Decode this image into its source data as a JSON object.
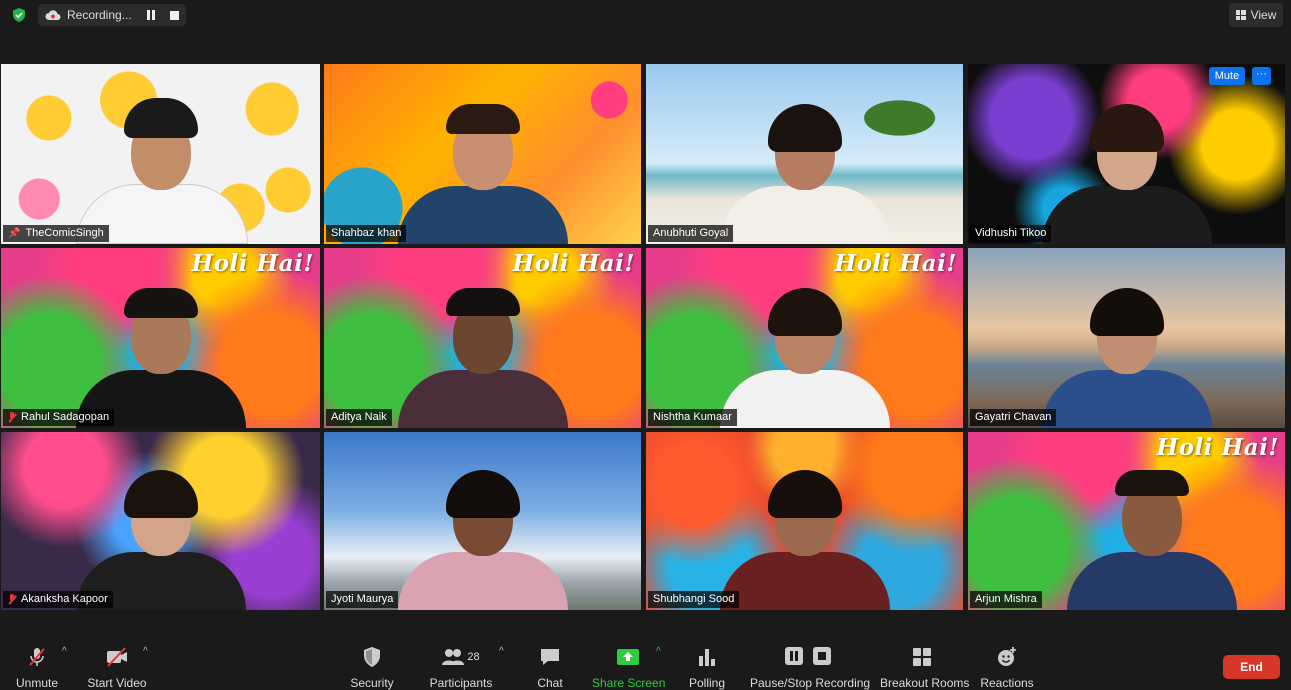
{
  "topbar": {
    "recording_label": "Recording...",
    "view_label": "View"
  },
  "tiles": [
    {
      "name": "TheComicSingh",
      "muted": false,
      "pinned": true,
      "holi": false
    },
    {
      "name": "Shahbaz khan",
      "muted": false,
      "holi": false
    },
    {
      "name": "Anubhuti Goyal",
      "muted": false,
      "holi": false
    },
    {
      "name": "Vidhushi Tikoo",
      "muted": false,
      "holi": false
    },
    {
      "name": "Rahul Sadagopan",
      "muted": true,
      "holi": true
    },
    {
      "name": "Aditya Naik",
      "muted": false,
      "holi": true
    },
    {
      "name": "Nishtha Kumaar",
      "muted": false,
      "holi": true
    },
    {
      "name": "Gayatri Chavan",
      "muted": false,
      "holi": false
    },
    {
      "name": "Akanksha Kapoor",
      "muted": true,
      "holi": false
    },
    {
      "name": "Jyoti Maurya",
      "muted": false,
      "holi": false
    },
    {
      "name": "Shubhangi Sood",
      "muted": false,
      "holi": false
    },
    {
      "name": "Arjun Mishra",
      "muted": false,
      "holi": true
    }
  ],
  "holi_text": "Holi Hai!",
  "hover_controls": {
    "mute": "Mute",
    "more": "···"
  },
  "toolbar": {
    "unmute": "Unmute",
    "start_video": "Start Video",
    "security": "Security",
    "participants": "Participants",
    "participants_count": "28",
    "chat": "Chat",
    "share_screen": "Share Screen",
    "polling": "Polling",
    "pause_stop_recording": "Pause/Stop Recording",
    "breakout_rooms": "Breakout Rooms",
    "reactions": "Reactions",
    "end": "End"
  },
  "colors": {
    "active_speaker_border": "#d9f07a",
    "share_green": "#2ecc40",
    "end_red": "#d9362a",
    "mute_blue": "#0e72ed"
  }
}
